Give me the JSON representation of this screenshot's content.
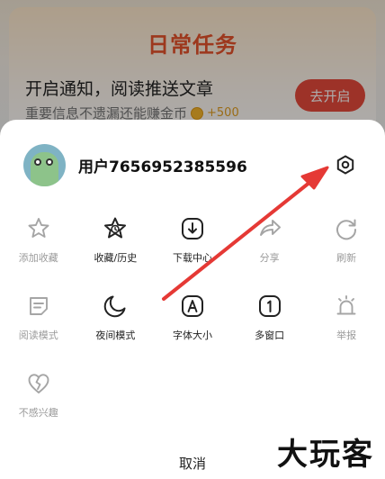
{
  "background": {
    "title": "日常任务",
    "notify_title": "开启通知，阅读推送文章",
    "notify_sub": "重要信息不遗漏还能赚金币",
    "coin_amount": "+500",
    "enable_button": "去开启"
  },
  "sheet": {
    "username": "用户7656952385596",
    "rows": [
      [
        {
          "label": "添加收藏",
          "icon": "star-outline-icon",
          "disabled": true
        },
        {
          "label": "收藏/历史",
          "icon": "star-clock-icon",
          "disabled": false
        },
        {
          "label": "下载中心",
          "icon": "download-icon",
          "disabled": false
        },
        {
          "label": "分享",
          "icon": "share-icon",
          "disabled": true
        },
        {
          "label": "刷新",
          "icon": "refresh-icon",
          "disabled": true
        }
      ],
      [
        {
          "label": "阅读模式",
          "icon": "reader-icon",
          "disabled": true
        },
        {
          "label": "夜间模式",
          "icon": "moon-icon",
          "disabled": false
        },
        {
          "label": "字体大小",
          "icon": "font-size-icon",
          "disabled": false
        },
        {
          "label": "多窗口",
          "icon": "multi-window-icon",
          "disabled": false
        },
        {
          "label": "举报",
          "icon": "alarm-icon",
          "disabled": true
        }
      ],
      [
        {
          "label": "不感兴趣",
          "icon": "broken-heart-icon",
          "disabled": true
        }
      ]
    ],
    "cancel_label": "取消"
  },
  "watermark": "大玩客",
  "colors": {
    "accent_red": "#e84a3b",
    "title_orange": "#e7532c",
    "annotation_arrow": "#e53935"
  }
}
